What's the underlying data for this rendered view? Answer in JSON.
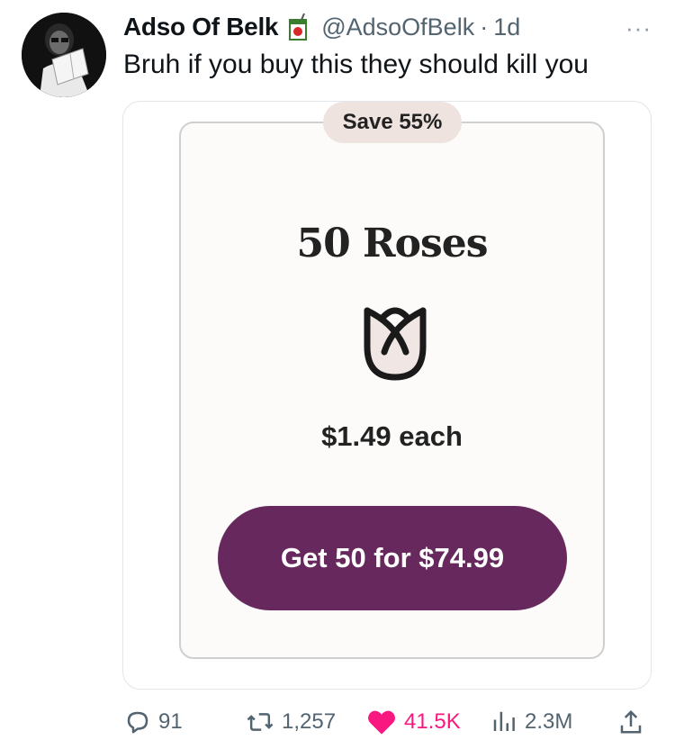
{
  "tweet": {
    "author_name": "Adso Of Belk",
    "handle": "@AdsoOfBelk",
    "separator": "·",
    "time": "1d",
    "more": "···",
    "text": "Bruh if you buy this they should kill you"
  },
  "card": {
    "badge": "Save 55%",
    "title": "50 Roses",
    "price": "$1.49 each",
    "cta": "Get 50 for $74.99"
  },
  "actions": {
    "replies": "91",
    "reposts": "1,257",
    "likes": "41.5K",
    "views": "2.3M"
  },
  "colors": {
    "cta_bg": "#66285d",
    "badge_bg": "#efe3df",
    "like": "#f91880",
    "muted": "#536471"
  }
}
